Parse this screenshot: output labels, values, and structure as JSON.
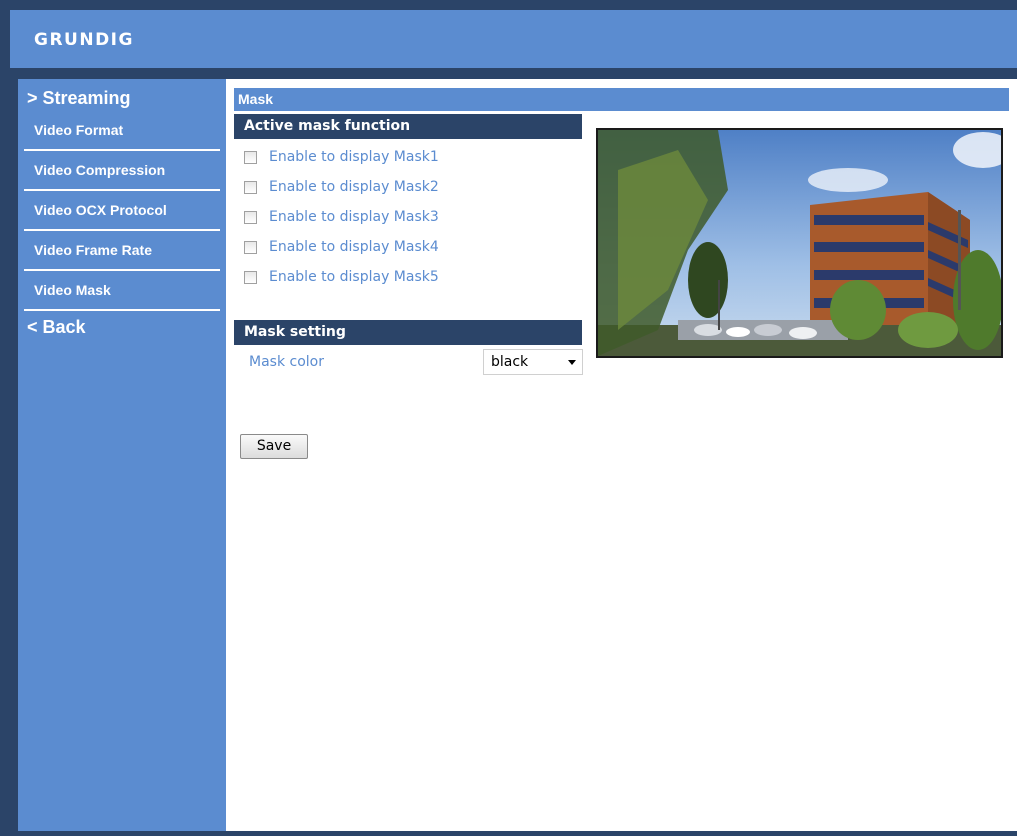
{
  "brand": {
    "logo": "GRUNDIG"
  },
  "sidebar": {
    "header": "> Streaming",
    "items": [
      {
        "label": "Video Format"
      },
      {
        "label": "Video Compression"
      },
      {
        "label": "Video OCX Protocol"
      },
      {
        "label": "Video Frame Rate"
      },
      {
        "label": "Video Mask"
      }
    ],
    "back": "< Back"
  },
  "page": {
    "title": "Mask",
    "active_mask": {
      "heading": "Active mask function",
      "masks": [
        {
          "label": "Enable to display Mask1",
          "checked": false
        },
        {
          "label": "Enable to display Mask2",
          "checked": false
        },
        {
          "label": "Enable to display Mask3",
          "checked": false
        },
        {
          "label": "Enable to display Mask4",
          "checked": false
        },
        {
          "label": "Enable to display Mask5",
          "checked": false
        }
      ]
    },
    "mask_setting": {
      "heading": "Mask setting",
      "color_label": "Mask color",
      "color_value": "black"
    },
    "save_label": "Save"
  },
  "colors": {
    "accent": "#5b8cd0",
    "dark": "#2b4468"
  }
}
